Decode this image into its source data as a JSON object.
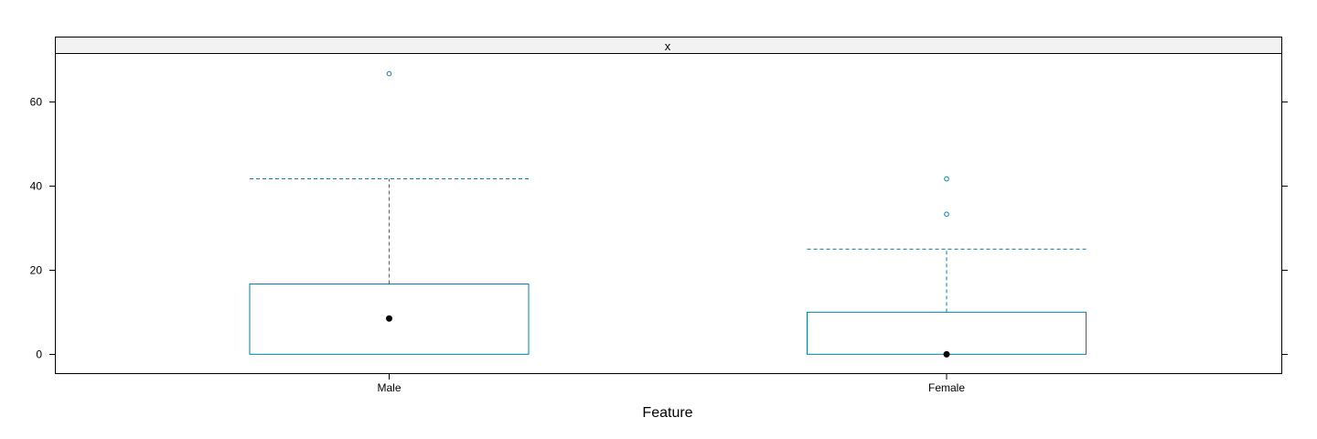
{
  "chart_data": {
    "type": "boxplot",
    "strip_label": "x",
    "xlabel": "Feature",
    "ylabel": "",
    "ylim": [
      -4.6,
      71.5
    ],
    "yticks": [
      0,
      20,
      40,
      60
    ],
    "grid": false,
    "colors": {
      "box": "#0080a8",
      "median": "#000000",
      "strip_bg": "#f2f2f2",
      "frame": "#000000"
    },
    "categories": [
      "Male",
      "Female"
    ],
    "boxes": [
      {
        "category": "Male",
        "whisker_low": 0,
        "q1": 0,
        "median": 8.5,
        "q3": 16.7,
        "whisker_high": 41.7,
        "outliers": [
          66.7
        ]
      },
      {
        "category": "Female",
        "whisker_low": 0,
        "q1": 0,
        "median": 0,
        "q3": 10,
        "whisker_high": 25,
        "outliers": [
          33.3,
          41.7
        ]
      }
    ]
  }
}
